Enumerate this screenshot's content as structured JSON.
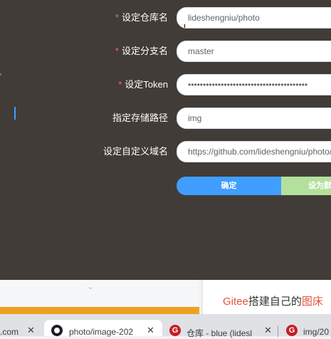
{
  "form": {
    "repo": {
      "label": "设定仓库名",
      "required": "*",
      "value": "lideshengniu/photo"
    },
    "branch": {
      "label": "设定分支名",
      "required": "*",
      "value": "master"
    },
    "token": {
      "label": "设定Token",
      "required": "*",
      "value": "••••••••••••••••••••••••••••••••••••••••"
    },
    "path": {
      "label": "指定存储路径",
      "value": "img"
    },
    "domain": {
      "label": "设定自定义域名",
      "value": "https://github.com/lideshengniu/photo/"
    },
    "buttons": {
      "confirm": "确定",
      "set_default": "设为默"
    }
  },
  "article": {
    "prefix": "Gitee",
    "middle": "搭建自己的",
    "suffix": "图床"
  },
  "tabs": [
    {
      "label": ".com",
      "close": "✕"
    },
    {
      "label": "photo/image-202",
      "close": "✕",
      "icon": "github-icon"
    },
    {
      "label": "仓库 - blue (lidesl",
      "close": "✕",
      "icon": "gitee-icon"
    },
    {
      "label": "img/20",
      "icon": "gitee-icon"
    }
  ],
  "colors": {
    "panel": "#413c37",
    "primary": "#409eff",
    "success_light": "#b3e19d",
    "required": "#f56c6c"
  }
}
